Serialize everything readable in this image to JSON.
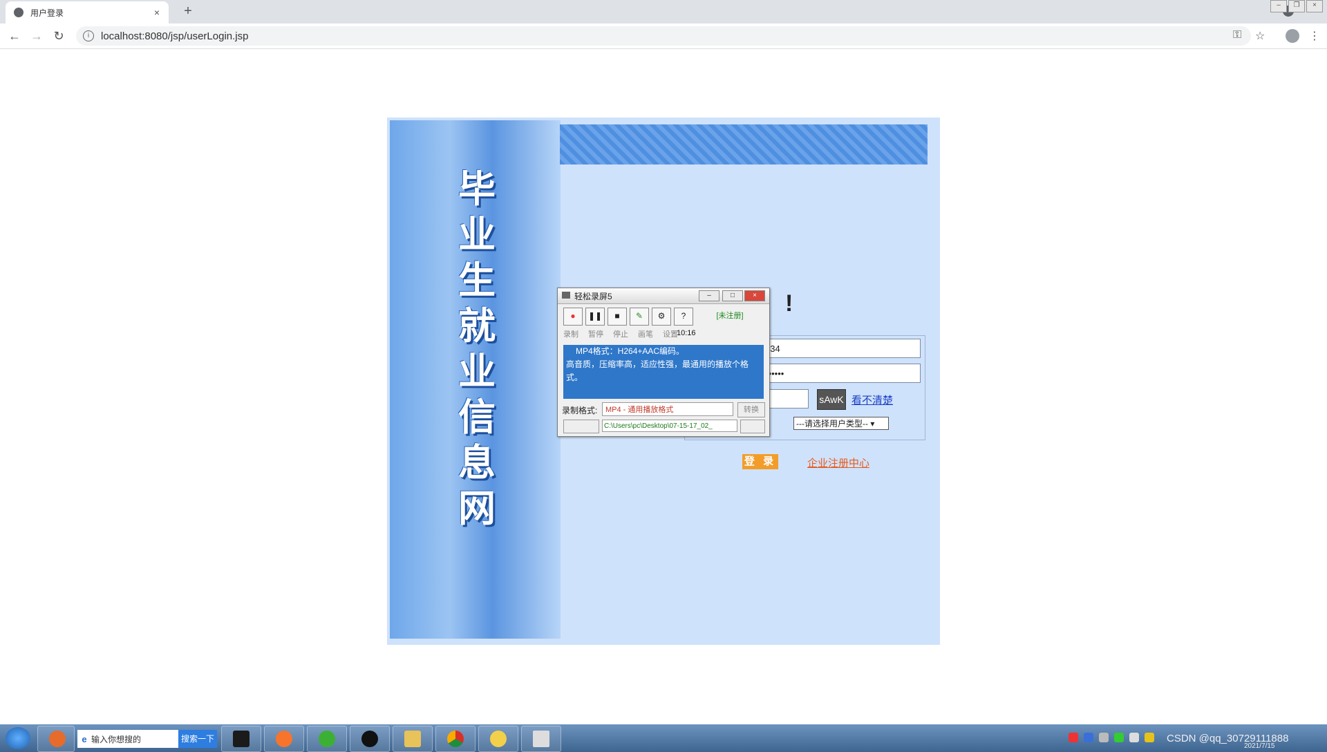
{
  "browser": {
    "tab_title": "用户登录",
    "url": "localhost:8080/jsp/userLogin.jsp"
  },
  "page": {
    "site_title": "毕业生就业信息网",
    "exclamation": "!",
    "username_value": "234",
    "password_value": "••••••",
    "captcha_text": "sAwK",
    "captcha_refresh": "看不清楚",
    "user_type_placeholder": "---请选择用户类型--",
    "login_button": "登 录",
    "register_link": "企业注册中心"
  },
  "recorder": {
    "title": "轻松录屏5",
    "unregistered": "[未注册]",
    "buttons": [
      "录制",
      "暂停",
      "停止",
      "画笔",
      "设置"
    ],
    "timer": "10:16",
    "info_line1": "MP4格式：H264+AAC编码。",
    "info_line2": "高音质，压缩率高，适应性强，最通用的播放个格式。",
    "format_label": "录制格式:",
    "format_value": "MP4 - 通用播放格式",
    "convert_button": "转换",
    "save_path": "C:\\Users\\pc\\Desktop\\07-15-17_02_"
  },
  "taskbar": {
    "search_placeholder": "输入你想搜的",
    "search_button": "搜索一下",
    "tray_text": "CSDN @qq_30729111888",
    "date": "2021/7/15"
  }
}
